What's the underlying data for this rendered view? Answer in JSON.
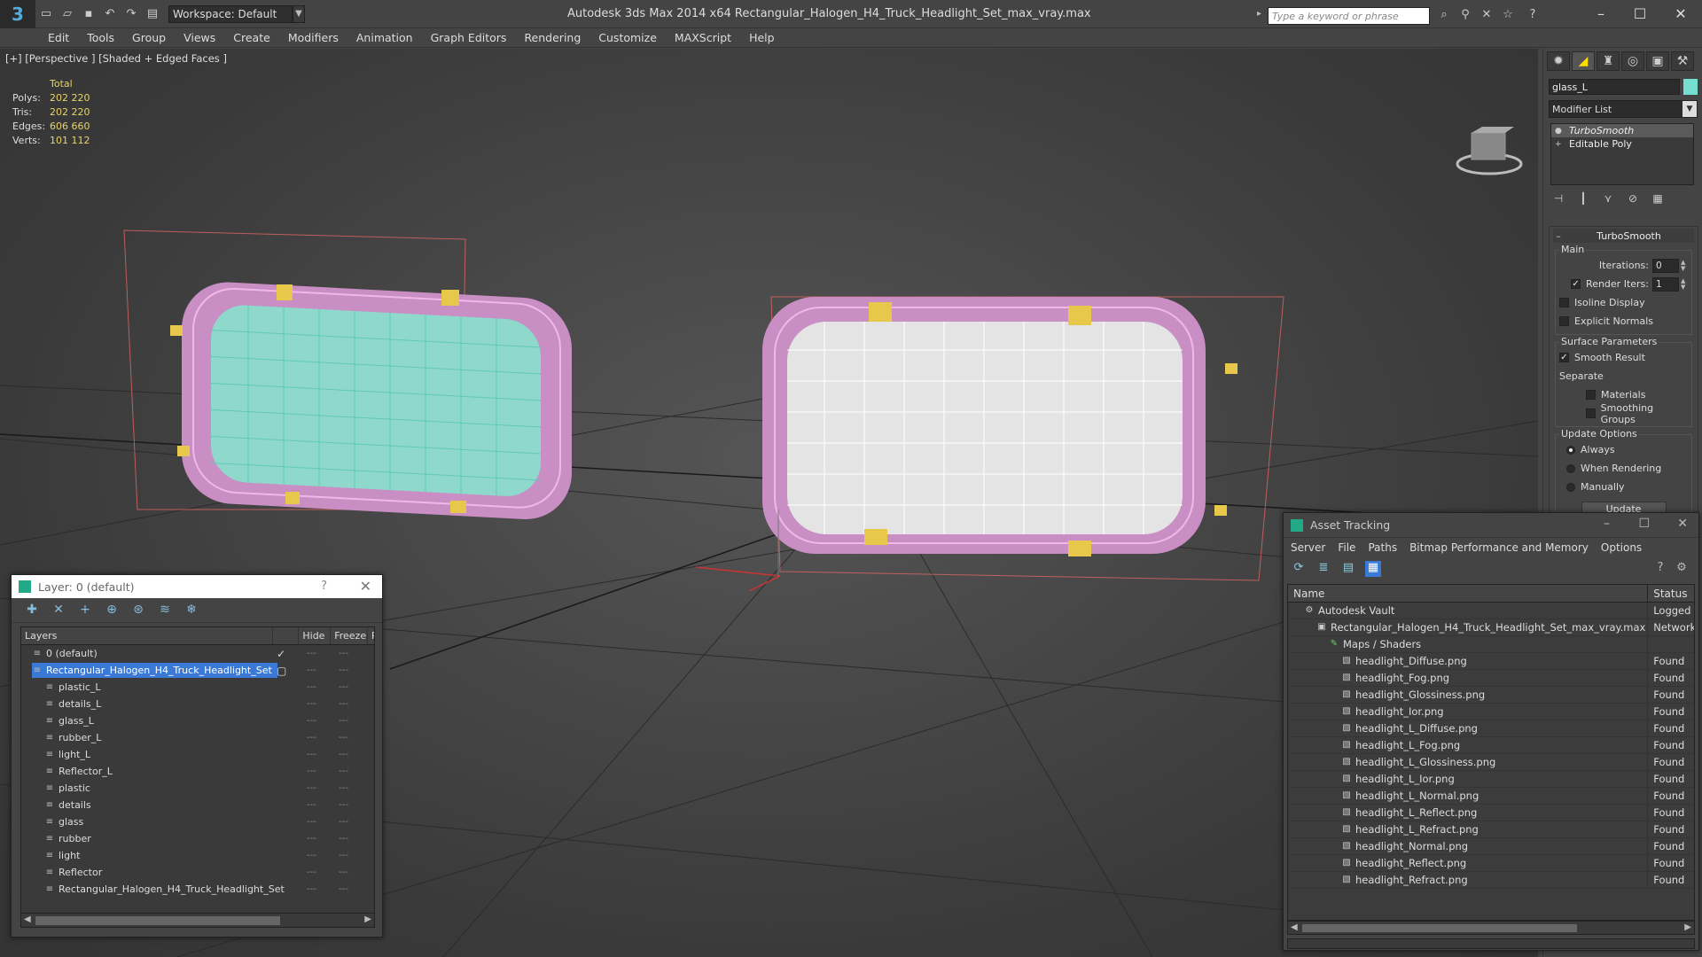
{
  "app": {
    "title": "Autodesk 3ds Max  2014 x64      Rectangular_Halogen_H4_Truck_Headlight_Set_max_vray.max",
    "logo_text": "3",
    "workspace": "Workspace: Default",
    "search_placeholder": "Type a keyword or phrase"
  },
  "menu": [
    "Edit",
    "Tools",
    "Group",
    "Views",
    "Create",
    "Modifiers",
    "Animation",
    "Graph Editors",
    "Rendering",
    "Customize",
    "MAXScript",
    "Help"
  ],
  "viewport": {
    "label": "[+] [Perspective ] [Shaded + Edged Faces ]",
    "stats_header": "Total",
    "stats": [
      {
        "label": "Polys:",
        "value": "202 220"
      },
      {
        "label": "Tris:",
        "value": "202 220"
      },
      {
        "label": "Edges:",
        "value": "606 660"
      },
      {
        "label": "Verts:",
        "value": "101 112"
      }
    ],
    "colors": {
      "wire": "#e89be0",
      "glass_wire": "#74e0cf",
      "clip": "#e8c84a",
      "bbox": "#d66"
    }
  },
  "command_panel": {
    "object_name": "glass_L",
    "object_color": "#74e0cf",
    "modifier_list": "Modifier List",
    "stack": [
      "TurboSmooth",
      "Editable Poly"
    ],
    "rollout_title": "TurboSmooth",
    "main_group": "Main",
    "iterations_label": "Iterations:",
    "iterations_value": "0",
    "render_iters_label": "Render Iters:",
    "render_iters_value": "1",
    "isoline_label": "Isoline Display",
    "explicit_normals_label": "Explicit Normals",
    "surface_group": "Surface Parameters",
    "smooth_result_label": "Smooth Result",
    "separate_label": "Separate",
    "materials_label": "Materials",
    "smoothing_groups_label": "Smoothing Groups",
    "update_group": "Update Options",
    "always_label": "Always",
    "when_rendering_label": "When Rendering",
    "manually_label": "Manually",
    "update_button": "Update"
  },
  "layer_window": {
    "title": "Layer: 0 (default)",
    "help": "?",
    "columns": {
      "layers": "Layers",
      "hide": "Hide",
      "freeze": "Freeze",
      "r": "R"
    },
    "rows": [
      {
        "name": "0 (default)",
        "indent": 1,
        "current": true
      },
      {
        "name": "Rectangular_Halogen_H4_Truck_Headlight_Set",
        "indent": 1,
        "selected": true
      },
      {
        "name": "plastic_L",
        "indent": 2
      },
      {
        "name": "details_L",
        "indent": 2
      },
      {
        "name": "glass_L",
        "indent": 2
      },
      {
        "name": "rubber_L",
        "indent": 2
      },
      {
        "name": "light_L",
        "indent": 2
      },
      {
        "name": "Reflector_L",
        "indent": 2
      },
      {
        "name": "plastic",
        "indent": 2
      },
      {
        "name": "details",
        "indent": 2
      },
      {
        "name": "glass",
        "indent": 2
      },
      {
        "name": "rubber",
        "indent": 2
      },
      {
        "name": "light",
        "indent": 2
      },
      {
        "name": "Reflector",
        "indent": 2
      },
      {
        "name": "Rectangular_Halogen_H4_Truck_Headlight_Set",
        "indent": 2
      }
    ]
  },
  "asset_window": {
    "title": "Asset Tracking",
    "menu": [
      "Server",
      "File",
      "Paths",
      "Bitmap Performance and Memory",
      "Options"
    ],
    "columns": {
      "name": "Name",
      "status": "Status"
    },
    "rows": [
      {
        "name": "Autodesk Vault",
        "status": "Logged O",
        "indent": 1,
        "icon": "vault"
      },
      {
        "name": "Rectangular_Halogen_H4_Truck_Headlight_Set_max_vray.max",
        "status": "Network",
        "indent": 2,
        "icon": "max"
      },
      {
        "name": "Maps / Shaders",
        "status": "",
        "indent": 3,
        "icon": "maps"
      },
      {
        "name": "headlight_Diffuse.png",
        "status": "Found",
        "indent": 4,
        "icon": "file"
      },
      {
        "name": "headlight_Fog.png",
        "status": "Found",
        "indent": 4,
        "icon": "file"
      },
      {
        "name": "headlight_Glossiness.png",
        "status": "Found",
        "indent": 4,
        "icon": "file"
      },
      {
        "name": "headlight_Ior.png",
        "status": "Found",
        "indent": 4,
        "icon": "file"
      },
      {
        "name": "headlight_L_Diffuse.png",
        "status": "Found",
        "indent": 4,
        "icon": "file"
      },
      {
        "name": "headlight_L_Fog.png",
        "status": "Found",
        "indent": 4,
        "icon": "file"
      },
      {
        "name": "headlight_L_Glossiness.png",
        "status": "Found",
        "indent": 4,
        "icon": "file"
      },
      {
        "name": "headlight_L_Ior.png",
        "status": "Found",
        "indent": 4,
        "icon": "file"
      },
      {
        "name": "headlight_L_Normal.png",
        "status": "Found",
        "indent": 4,
        "icon": "file"
      },
      {
        "name": "headlight_L_Reflect.png",
        "status": "Found",
        "indent": 4,
        "icon": "file"
      },
      {
        "name": "headlight_L_Refract.png",
        "status": "Found",
        "indent": 4,
        "icon": "file"
      },
      {
        "name": "headlight_Normal.png",
        "status": "Found",
        "indent": 4,
        "icon": "file"
      },
      {
        "name": "headlight_Reflect.png",
        "status": "Found",
        "indent": 4,
        "icon": "file"
      },
      {
        "name": "headlight_Refract.png",
        "status": "Found",
        "indent": 4,
        "icon": "file"
      }
    ]
  }
}
